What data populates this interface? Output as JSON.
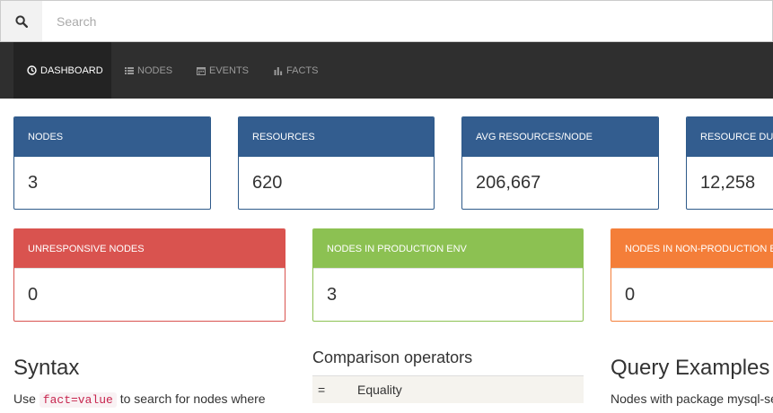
{
  "search": {
    "placeholder": "Search",
    "icon": "search-icon"
  },
  "nav": {
    "items": [
      {
        "label": "DASHBOARD",
        "icon": "clock-icon",
        "active": true
      },
      {
        "label": "NODES",
        "icon": "list-icon",
        "active": false
      },
      {
        "label": "EVENTS",
        "icon": "calendar-icon",
        "active": false
      },
      {
        "label": "FACTS",
        "icon": "bar-chart-icon",
        "active": false
      }
    ]
  },
  "stats_row1": [
    {
      "label": "NODES",
      "value": "3"
    },
    {
      "label": "RESOURCES",
      "value": "620"
    },
    {
      "label": "AVG RESOURCES/NODE",
      "value": "206,667"
    },
    {
      "label": "RESOURCE DUPL",
      "value": "12,258"
    }
  ],
  "stats_row2": [
    {
      "label": "UNRESPONSIVE NODES",
      "value": "0"
    },
    {
      "label": "NODES IN PRODUCTION ENV",
      "value": "3"
    },
    {
      "label": "NODES IN NON-PRODUCTION EN",
      "value": "0"
    }
  ],
  "syntax": {
    "title": "Syntax",
    "line1_prefix": "Use",
    "line1_code": "fact=value",
    "line1_suffix": "to search for nodes where"
  },
  "operators": {
    "title": "Comparison operators",
    "rows": [
      {
        "symbol": "=",
        "meaning": "Equality"
      }
    ]
  },
  "query_examples": {
    "title": "Query Examples",
    "line1": "Nodes with package mysql-se"
  },
  "colors": {
    "navbar": "#2f2f2f",
    "blue_panel": "#335d8f",
    "red_panel": "#d9534f",
    "green_panel": "#8cc152",
    "orange_panel": "#f47e39"
  }
}
